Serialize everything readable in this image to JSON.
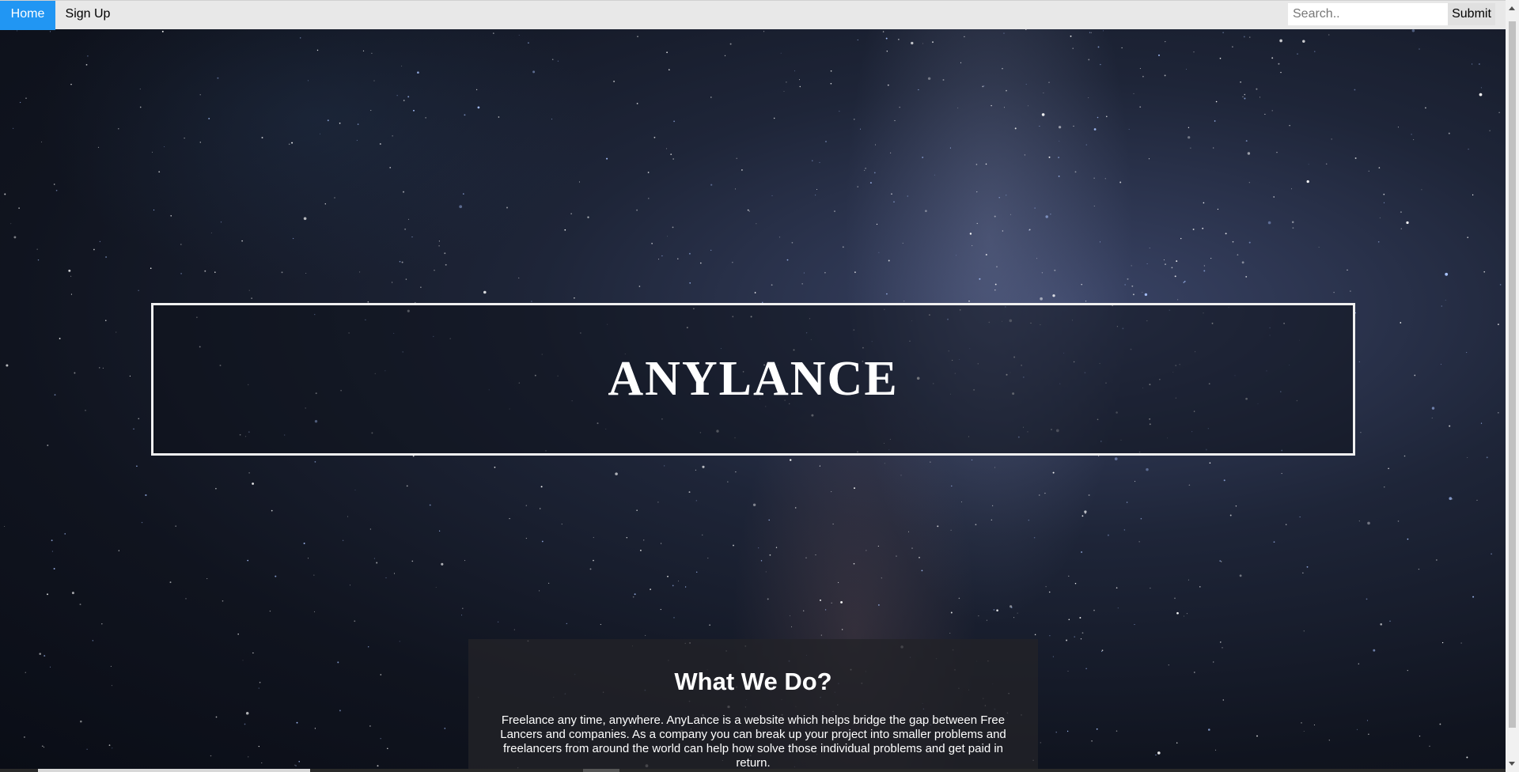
{
  "nav": {
    "home_label": "Home",
    "signup_label": "Sign Up",
    "search_placeholder": "Search..",
    "submit_label": "Submit",
    "active_color": "#2196F3"
  },
  "hero": {
    "title": "ANYLANCE"
  },
  "about": {
    "heading": "What We Do?",
    "body": "Freelance any time, anywhere. AnyLance is a website which helps bridge the gap between Free Lancers and companies. As a company you can break up your project into smaller problems and freelancers from around the world can help how solve those individual problems and get paid in return."
  },
  "background": {
    "icon": "starry-night-sky-image"
  }
}
